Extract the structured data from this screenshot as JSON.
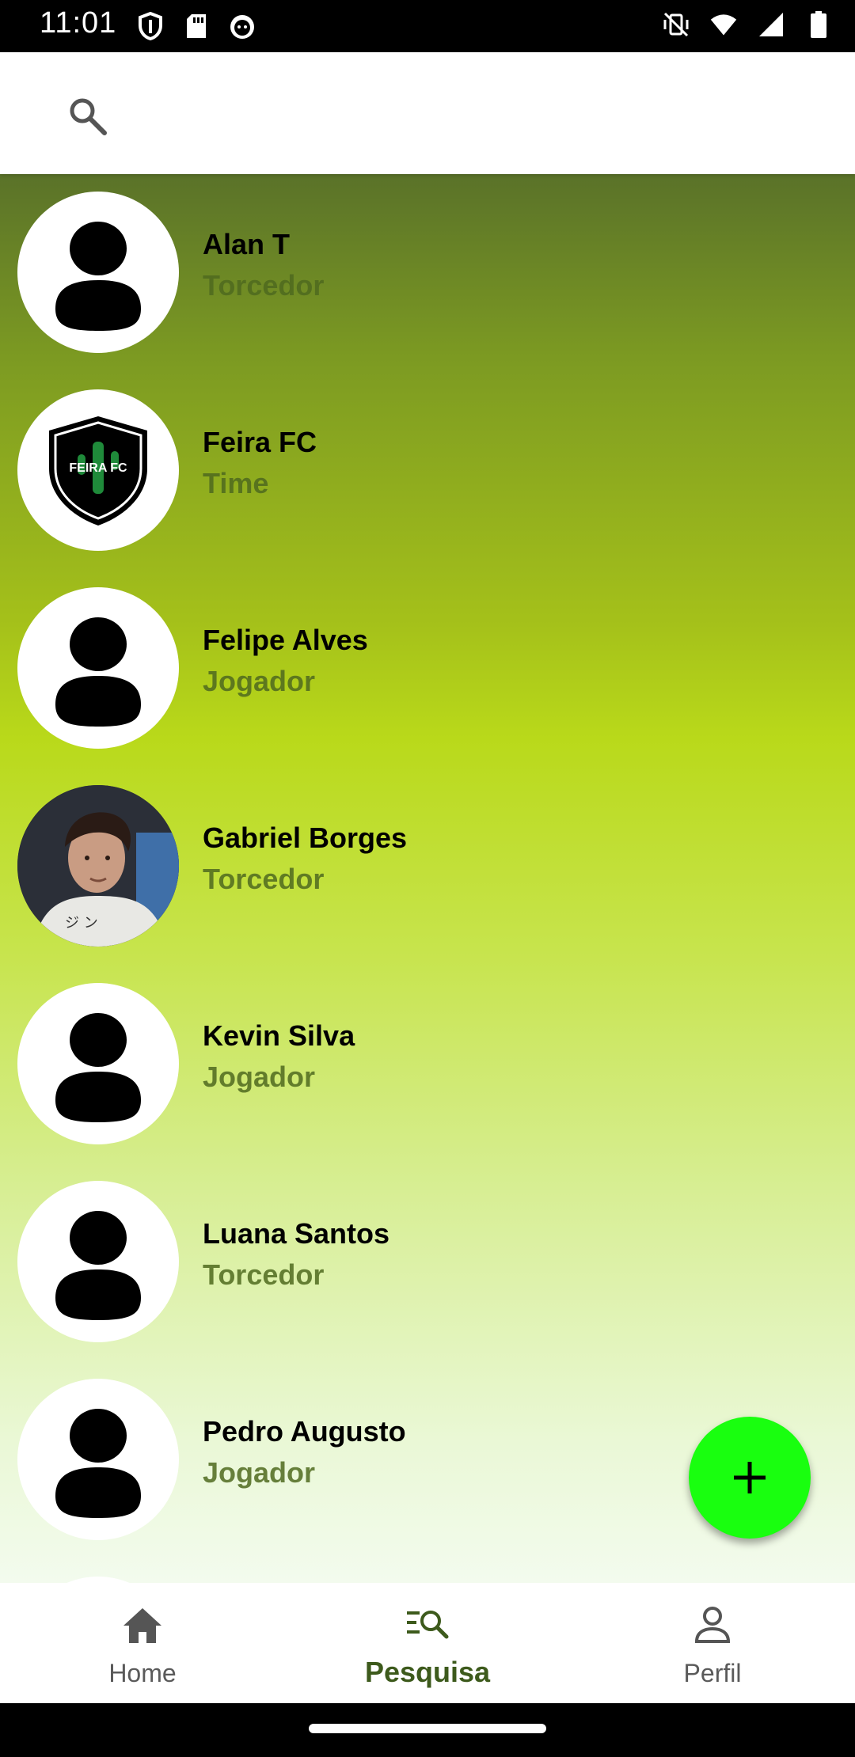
{
  "status_bar": {
    "time": "11:01",
    "left_icons": [
      "shield-icon",
      "sd-card-icon",
      "cat-icon"
    ],
    "right_icons": [
      "vibrate-off-icon",
      "wifi-icon",
      "signal-icon",
      "battery-icon"
    ]
  },
  "header": {
    "search_icon": "search-icon"
  },
  "list": {
    "items": [
      {
        "name": "Alan T",
        "role": "Torcedor",
        "avatar": "person-avatar"
      },
      {
        "name": "Feira FC",
        "role": "Time",
        "avatar": "team-crest",
        "crest_text": "FEIRA FC"
      },
      {
        "name": "Felipe Alves",
        "role": "Jogador",
        "avatar": "person-avatar"
      },
      {
        "name": "Gabriel Borges",
        "role": "Torcedor",
        "avatar": "photo-avatar"
      },
      {
        "name": "Kevin Silva",
        "role": "Jogador",
        "avatar": "person-avatar"
      },
      {
        "name": "Luana Santos",
        "role": "Torcedor",
        "avatar": "person-avatar"
      },
      {
        "name": "Pedro Augusto",
        "role": "Jogador",
        "avatar": "person-avatar"
      }
    ]
  },
  "fab": {
    "icon": "plus-icon",
    "color": "#19ff0f"
  },
  "bottom_nav": {
    "items": [
      {
        "label": "Home",
        "icon": "home-icon"
      },
      {
        "label": "Pesquisa",
        "icon": "search-list-icon",
        "active": true
      },
      {
        "label": "Perfil",
        "icon": "person-icon"
      }
    ]
  },
  "colors": {
    "gradient_top": "#5a7229",
    "gradient_mid": "#b9d91a",
    "gradient_bottom": "#f3fbee",
    "role_text": "#4f6a1f",
    "nav_active": "#3d5a1c"
  }
}
